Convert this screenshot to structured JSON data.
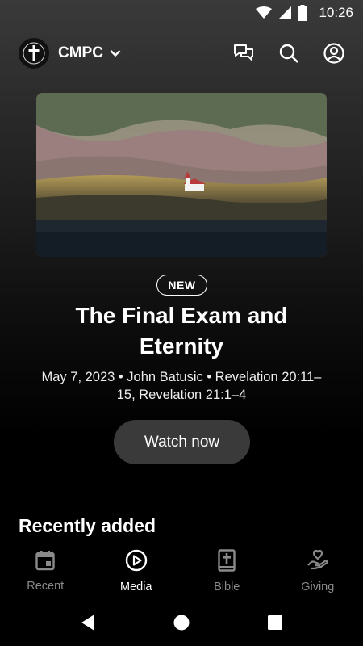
{
  "status_bar": {
    "time": "10:26"
  },
  "header": {
    "org_name": "CMPC",
    "icons": [
      "cross-logo",
      "chat-icon",
      "search-icon",
      "account-icon"
    ]
  },
  "hero": {
    "badge": "NEW",
    "title": "The Final Exam and Eternity",
    "meta": "May 7, 2023 • John Batusic • Revelation 20:11–15, Revelation 21:1–4",
    "watch_label": "Watch now"
  },
  "sections": {
    "recently_added": "Recently added"
  },
  "bottom_nav": {
    "active": "Media",
    "items": [
      {
        "label": "Recent",
        "icon": "calendar-icon"
      },
      {
        "label": "Media",
        "icon": "play-circle-icon"
      },
      {
        "label": "Bible",
        "icon": "bible-icon"
      },
      {
        "label": "Giving",
        "icon": "giving-hand-icon"
      }
    ]
  },
  "colors": {
    "background": "#000000",
    "button_bg": "#3a3a3a",
    "inactive": "#8a8a8a",
    "active": "#ffffff"
  }
}
